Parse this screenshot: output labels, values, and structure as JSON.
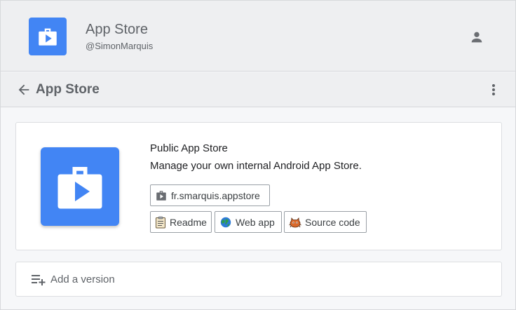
{
  "header": {
    "title": "App Store",
    "handle": "@SimonMarquis",
    "logo_icon": "app-store-bag-icon",
    "account_icon": "person-icon"
  },
  "toolbar": {
    "back_icon": "arrow-back-icon",
    "title": "App Store",
    "more_icon": "more-vert-icon"
  },
  "app": {
    "name": "Public App Store",
    "description": "Manage your own internal Android App Store.",
    "package": "fr.smarquis.appstore",
    "links": [
      {
        "label": "Readme",
        "icon": "clipboard-icon"
      },
      {
        "label": "Web app",
        "icon": "globe-icon"
      },
      {
        "label": "Source code",
        "icon": "octocat-icon"
      }
    ]
  },
  "actions": {
    "add_version": "Add a version",
    "add_version_icon": "playlist-add-icon"
  },
  "colors": {
    "brand": "#4285f4",
    "header_bg": "#eeeff1",
    "page_bg": "#f6f7f9"
  }
}
